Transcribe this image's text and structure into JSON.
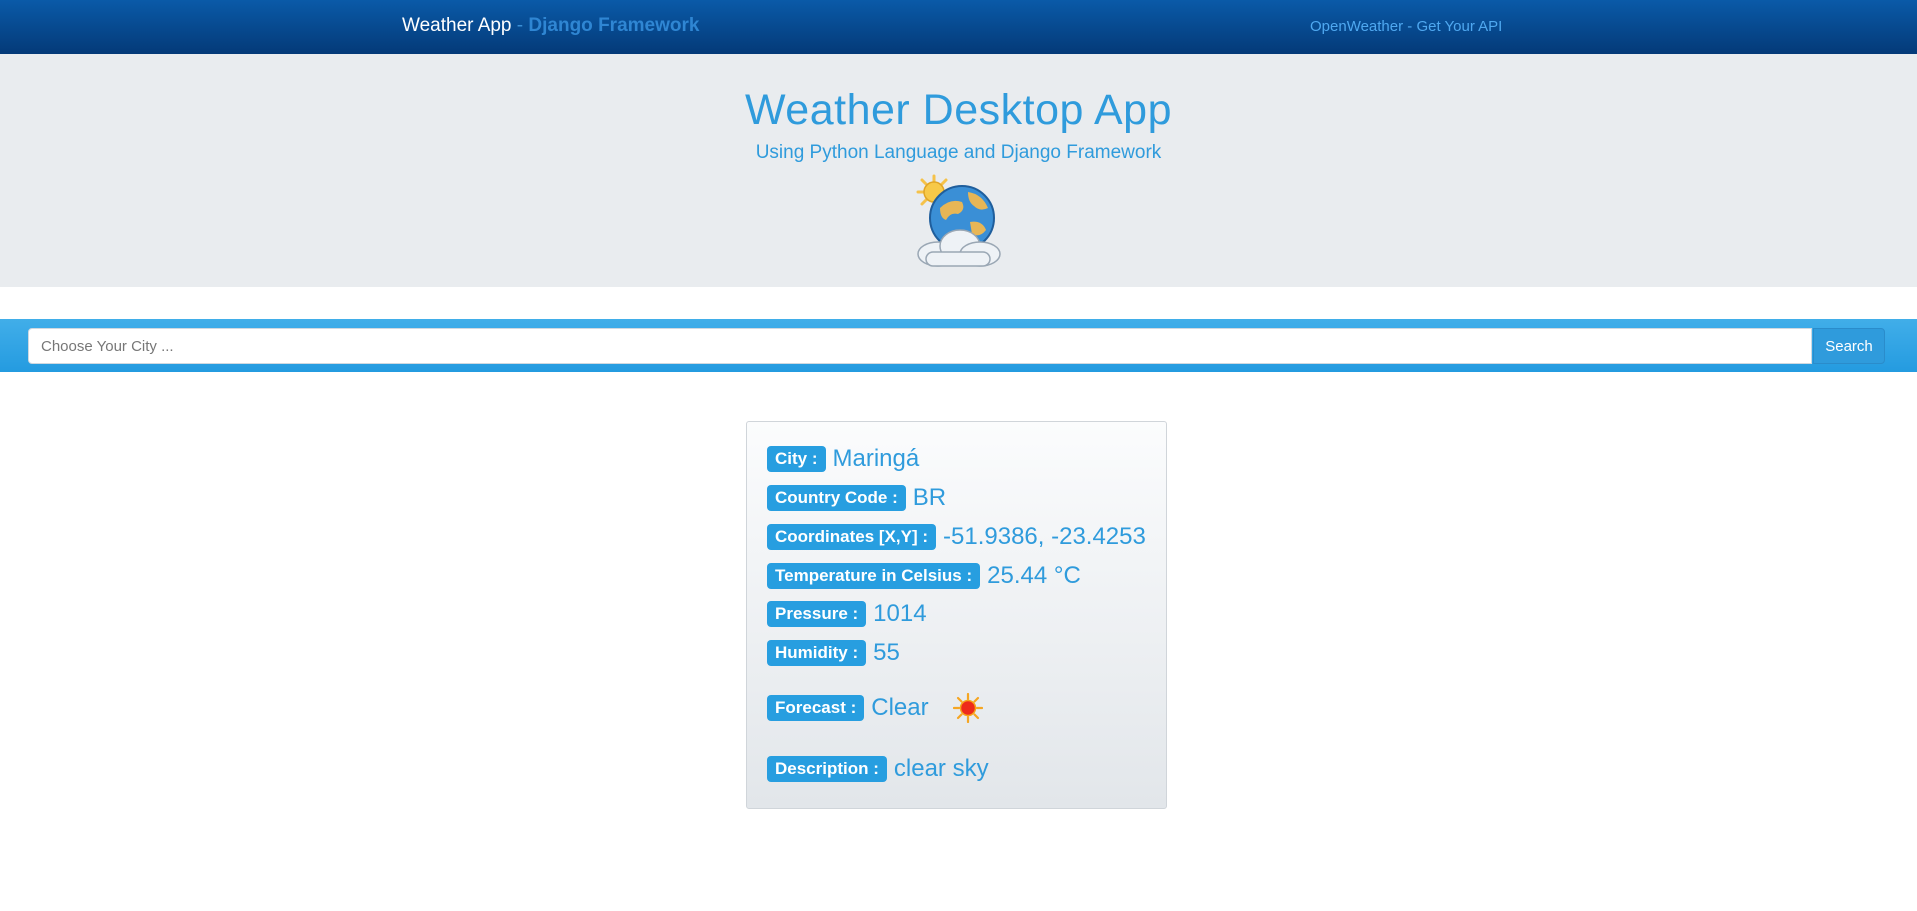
{
  "navbar": {
    "brand": "Weather App",
    "brand_sep": " - ",
    "brand_framework": "Django Framework",
    "link": "OpenWeather - Get Your API"
  },
  "hero": {
    "title": "Weather Desktop App",
    "subtitle": "Using Python Language and Django Framework",
    "icon": "sun-cloud-globe-icon"
  },
  "search": {
    "placeholder": "Choose Your City ...",
    "value": "",
    "button_label": "Search"
  },
  "result": {
    "city_label": "City :",
    "city": "Maringá",
    "country_label": "Country Code :",
    "country": "BR",
    "coords_label": "Coordinates [X,Y] :",
    "coords": "-51.9386, -23.4253",
    "temp_label": "Temperature in Celsius :",
    "temp": "25.44 °C",
    "pressure_label": "Pressure :",
    "pressure": "1014",
    "humidity_label": "Humidity :",
    "humidity": "55",
    "forecast_label": "Forecast :",
    "forecast": "Clear",
    "forecast_icon": "sun-icon",
    "description_label": "Description :",
    "description": "clear sky"
  },
  "colors": {
    "navbar": "#043a78",
    "accent": "#2f9bdc",
    "hero_bg": "#e9ecef"
  }
}
